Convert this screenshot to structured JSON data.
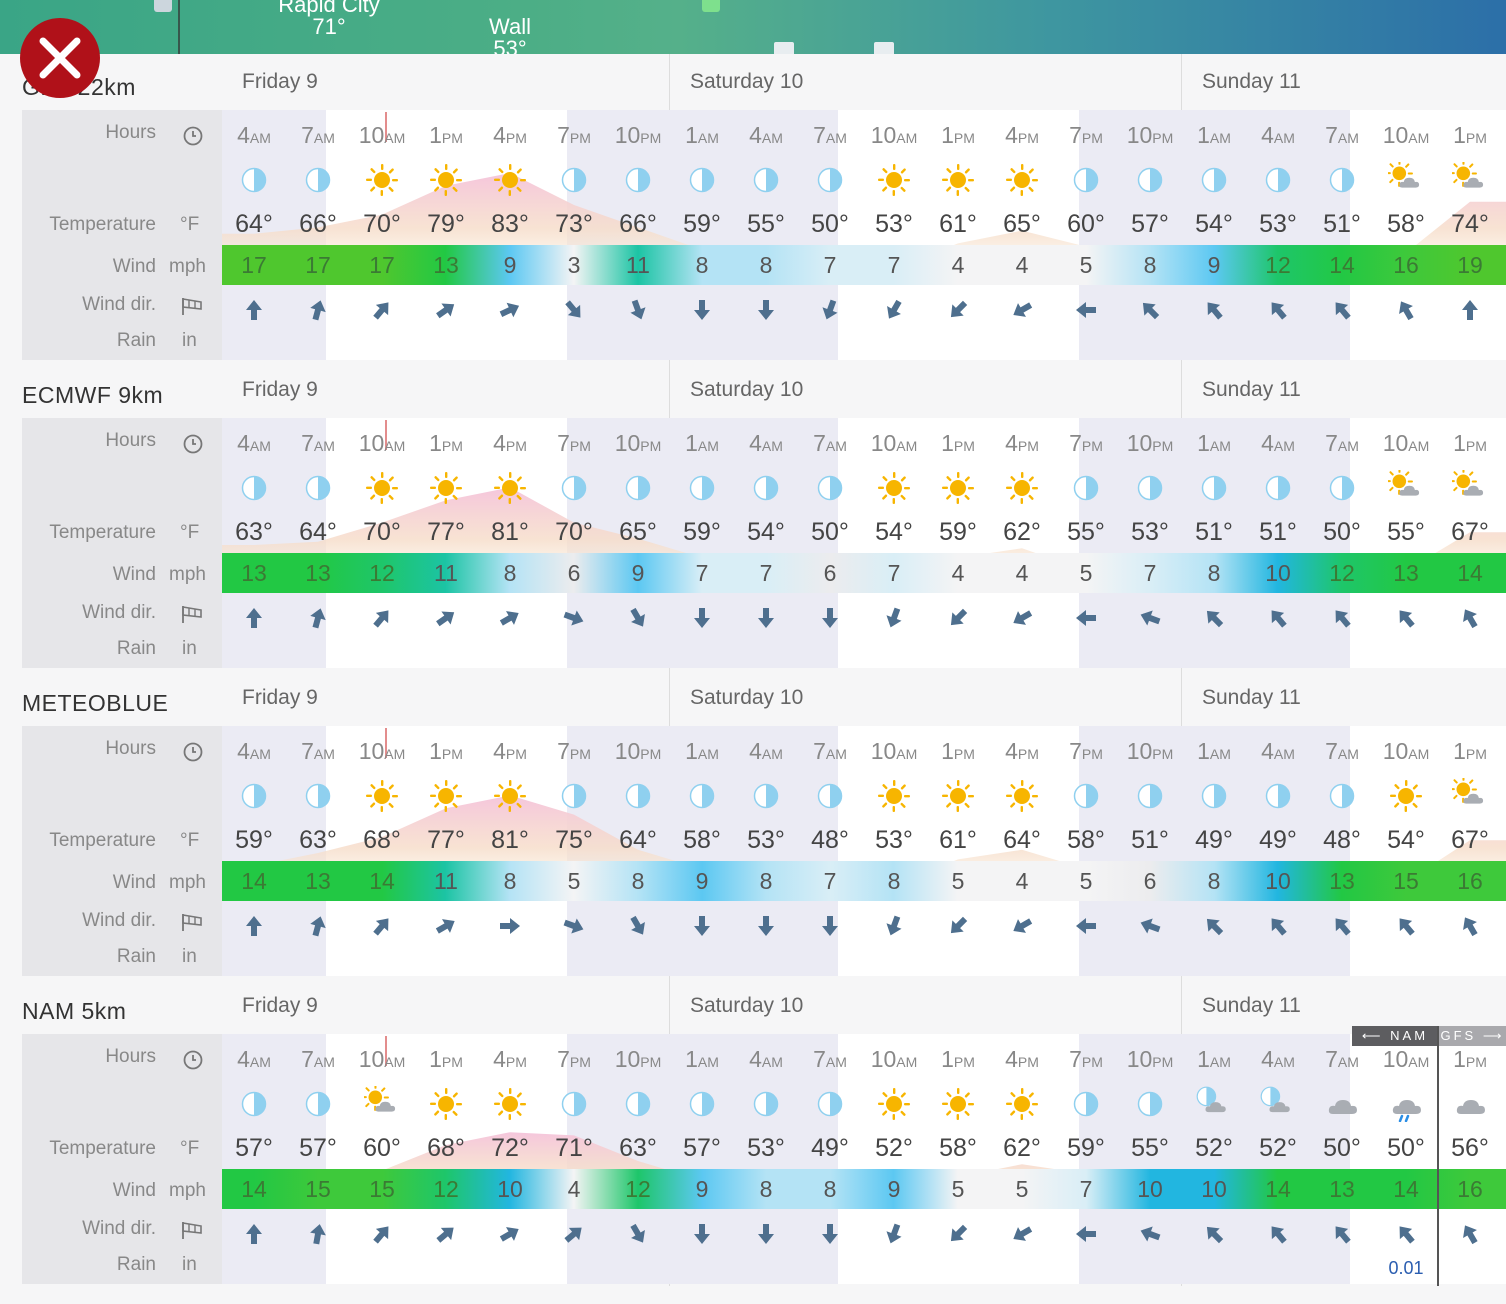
{
  "map": {
    "cities": [
      {
        "name": "Rapid City",
        "temp": "71°"
      },
      {
        "name": "Wall",
        "temp": "53°"
      }
    ]
  },
  "labels": {
    "hours": "Hours",
    "temperature": "Temperature",
    "temp_unit": "°F",
    "wind": "Wind",
    "wind_unit": "mph",
    "wind_dir": "Wind dir.",
    "rain": "Rain",
    "rain_unit": "in"
  },
  "days": [
    "Friday 9",
    "Saturday 10",
    "Sunday 11"
  ],
  "hours": [
    {
      "n": "4",
      "p": "AM"
    },
    {
      "n": "7",
      "p": "AM"
    },
    {
      "n": "10",
      "p": "AM"
    },
    {
      "n": "1",
      "p": "PM"
    },
    {
      "n": "4",
      "p": "PM"
    },
    {
      "n": "7",
      "p": "PM"
    },
    {
      "n": "10",
      "p": "PM"
    },
    {
      "n": "1",
      "p": "AM"
    },
    {
      "n": "4",
      "p": "AM"
    },
    {
      "n": "7",
      "p": "AM"
    },
    {
      "n": "10",
      "p": "AM"
    },
    {
      "n": "1",
      "p": "PM"
    },
    {
      "n": "4",
      "p": "PM"
    },
    {
      "n": "7",
      "p": "PM"
    },
    {
      "n": "10",
      "p": "PM"
    },
    {
      "n": "1",
      "p": "AM"
    },
    {
      "n": "4",
      "p": "AM"
    },
    {
      "n": "7",
      "p": "AM"
    },
    {
      "n": "10",
      "p": "AM"
    },
    {
      "n": "1",
      "p": "PM"
    }
  ],
  "colors": {
    "header_bg": "#f6f6f7",
    "label_bg": "#e6e6e9",
    "night_band": "#ebebf4",
    "close": "#b01119",
    "arrow": "#4e6f8e",
    "sun": "#f7b500",
    "moon": "#8fd0ef"
  },
  "models": [
    {
      "name": "GFS 22km",
      "icons": [
        "moon",
        "moon",
        "sun",
        "sun",
        "sun",
        "moon",
        "moon",
        "moon",
        "moon",
        "moon",
        "sun",
        "sun",
        "sun",
        "moon",
        "moon",
        "moon",
        "moon",
        "moon",
        "sun-cloud",
        "sun-cloud"
      ],
      "temps": [
        "64°",
        "66°",
        "70°",
        "79°",
        "83°",
        "73°",
        "66°",
        "59°",
        "55°",
        "50°",
        "53°",
        "61°",
        "65°",
        "60°",
        "57°",
        "54°",
        "53°",
        "51°",
        "58°",
        "74°"
      ],
      "wind": [
        17,
        17,
        17,
        13,
        9,
        3,
        11,
        8,
        8,
        7,
        7,
        4,
        4,
        5,
        8,
        9,
        12,
        14,
        16,
        19
      ],
      "dir": [
        0,
        15,
        40,
        55,
        65,
        140,
        160,
        180,
        180,
        200,
        210,
        225,
        240,
        270,
        315,
        320,
        320,
        320,
        330,
        0
      ],
      "rain": [
        "",
        "",
        "",
        "",
        "",
        "",
        "",
        "",
        "",
        "",
        "",
        "",
        "",
        "",
        "",
        "",
        "",
        "",
        "",
        ""
      ]
    },
    {
      "name": "ECMWF 9km",
      "icons": [
        "moon",
        "moon",
        "sun",
        "sun",
        "sun",
        "moon",
        "moon",
        "moon",
        "moon",
        "moon",
        "sun",
        "sun",
        "sun",
        "moon",
        "moon",
        "moon",
        "moon",
        "moon",
        "sun-cloud",
        "sun-cloud"
      ],
      "temps": [
        "63°",
        "64°",
        "70°",
        "77°",
        "81°",
        "70°",
        "65°",
        "59°",
        "54°",
        "50°",
        "54°",
        "59°",
        "62°",
        "55°",
        "53°",
        "51°",
        "51°",
        "50°",
        "55°",
        "67°"
      ],
      "wind": [
        13,
        13,
        12,
        11,
        8,
        6,
        9,
        7,
        7,
        6,
        7,
        4,
        4,
        5,
        7,
        8,
        10,
        12,
        13,
        14
      ],
      "dir": [
        0,
        15,
        40,
        55,
        60,
        110,
        150,
        180,
        180,
        180,
        200,
        225,
        240,
        270,
        290,
        315,
        320,
        320,
        320,
        330
      ],
      "rain": [
        "",
        "",
        "",
        "",
        "",
        "",
        "",
        "",
        "",
        "",
        "",
        "",
        "",
        "",
        "",
        "",
        "",
        "",
        "",
        ""
      ]
    },
    {
      "name": "METEOBLUE",
      "icons": [
        "moon",
        "moon",
        "sun",
        "sun",
        "sun",
        "moon",
        "moon",
        "moon",
        "moon",
        "moon",
        "sun",
        "sun",
        "sun",
        "moon",
        "moon",
        "moon",
        "moon",
        "moon",
        "sun",
        "sun-cloud"
      ],
      "temps": [
        "59°",
        "63°",
        "68°",
        "77°",
        "81°",
        "75°",
        "64°",
        "58°",
        "53°",
        "48°",
        "53°",
        "61°",
        "64°",
        "58°",
        "51°",
        "49°",
        "49°",
        "48°",
        "54°",
        "67°"
      ],
      "wind": [
        14,
        13,
        14,
        11,
        8,
        5,
        8,
        9,
        8,
        7,
        8,
        5,
        4,
        5,
        6,
        8,
        10,
        13,
        15,
        16
      ],
      "dir": [
        0,
        15,
        40,
        60,
        90,
        110,
        150,
        180,
        180,
        180,
        200,
        225,
        240,
        270,
        290,
        315,
        320,
        320,
        320,
        330
      ],
      "rain": [
        "",
        "",
        "",
        "",
        "",
        "",
        "",
        "",
        "",
        "",
        "",
        "",
        "",
        "",
        "",
        "",
        "",
        "",
        "",
        ""
      ]
    },
    {
      "name": "NAM 5km",
      "icons": [
        "moon",
        "moon",
        "sun-cloud",
        "sun",
        "sun",
        "moon",
        "moon",
        "moon",
        "moon",
        "moon",
        "sun",
        "sun",
        "sun",
        "moon",
        "moon",
        "moon-cloud",
        "moon-cloud",
        "cloud",
        "rain-cloud",
        "cloud"
      ],
      "temps": [
        "57°",
        "57°",
        "60°",
        "68°",
        "72°",
        "71°",
        "63°",
        "57°",
        "53°",
        "49°",
        "52°",
        "58°",
        "62°",
        "59°",
        "55°",
        "52°",
        "52°",
        "50°",
        "50°",
        "56°"
      ],
      "wind": [
        14,
        15,
        15,
        12,
        10,
        4,
        12,
        9,
        8,
        8,
        9,
        5,
        5,
        7,
        10,
        10,
        14,
        13,
        14,
        16
      ],
      "dir": [
        0,
        10,
        40,
        50,
        60,
        50,
        150,
        180,
        180,
        180,
        200,
        225,
        240,
        270,
        290,
        315,
        320,
        320,
        320,
        330
      ],
      "rain": [
        "",
        "",
        "",
        "",
        "",
        "",
        "",
        "",
        "",
        "",
        "",
        "",
        "",
        "",
        "",
        "",
        "",
        "",
        "0.01",
        ""
      ],
      "badges": {
        "nam": "⟵ NAM",
        "gfs": "GFS ⟶"
      }
    }
  ]
}
